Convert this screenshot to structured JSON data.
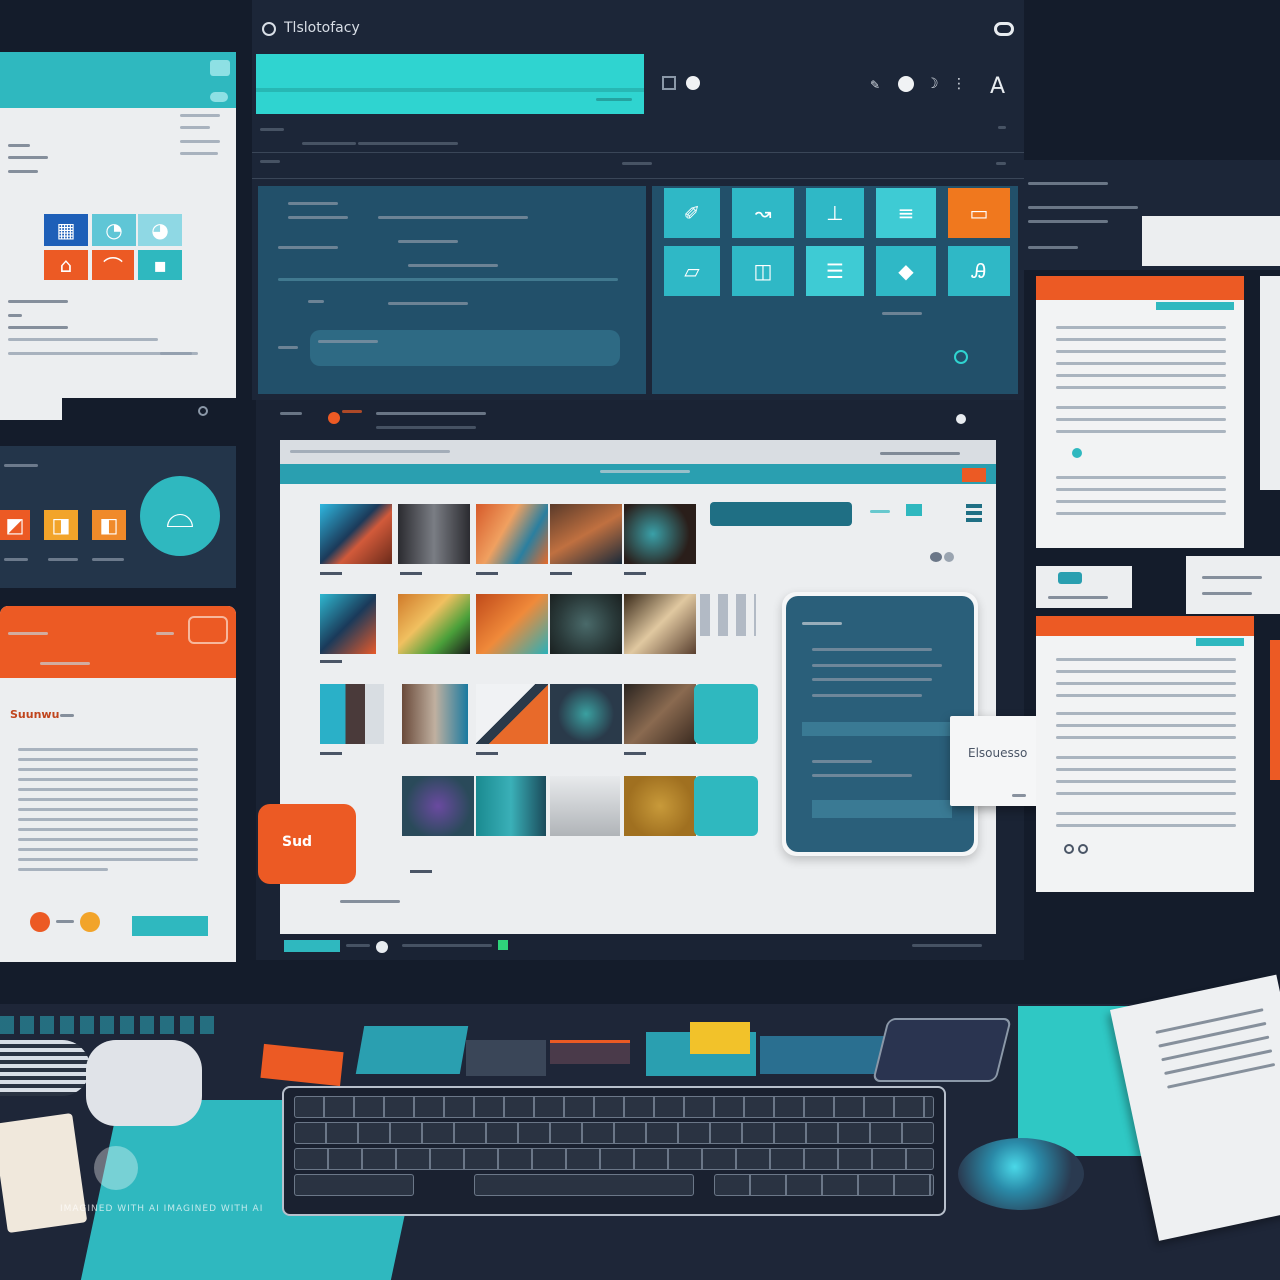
{
  "app": {
    "title": "Tlslotofacy"
  },
  "floating_card": {
    "label": "Elsouesso"
  },
  "orange_badge": {
    "label": "Sud"
  },
  "left_orange_panel": {
    "heading": "Suunwu"
  },
  "watermark": {
    "text": "IMAGINED WITH AI  IMAGINED WITH AI"
  },
  "colors": {
    "teal": "#2fb8bf",
    "deep_teal": "#1f6f84",
    "orange": "#ec5a24",
    "navy": "#141c2b",
    "panel": "#1c2638",
    "paper": "#eceef0"
  },
  "icons": {
    "toolbar": [
      "square-icon",
      "dot-icon",
      "pin-icon",
      "moon-icon",
      "font-icon"
    ],
    "tiles": [
      "eraser-icon",
      "brush-icon",
      "crop-icon",
      "layout-icon",
      "image-icon",
      "ruler-icon",
      "split-icon",
      "table-icon",
      "diamond-icon",
      "signature-icon"
    ]
  }
}
